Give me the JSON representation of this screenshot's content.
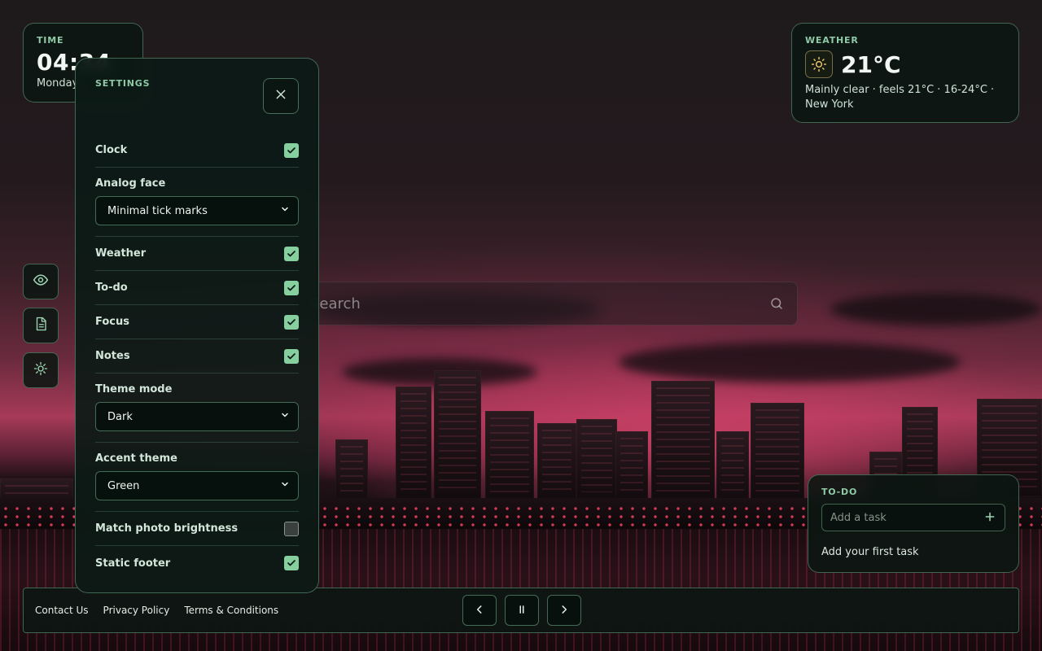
{
  "time_widget": {
    "label": "TIME",
    "time": "04:34",
    "day": "Monday"
  },
  "weather_widget": {
    "label": "WEATHER",
    "icon": "sun-icon",
    "temperature": "21°C",
    "description": "Mainly clear · feels 21°C · 16-24°C · New York"
  },
  "search": {
    "placeholder": "Search",
    "icon": "search-icon"
  },
  "side_rail": [
    {
      "id": "eye",
      "icon": "eye-icon"
    },
    {
      "id": "notes",
      "icon": "document-icon"
    },
    {
      "id": "settings",
      "icon": "gear-icon"
    }
  ],
  "settings": {
    "title": "SETTINGS",
    "close_icon": "close-icon",
    "clock": {
      "label": "Clock",
      "checked": true
    },
    "analog_face": {
      "label": "Analog face",
      "value": "Minimal tick marks"
    },
    "weather": {
      "label": "Weather",
      "checked": true
    },
    "todo": {
      "label": "To-do",
      "checked": true
    },
    "focus": {
      "label": "Focus",
      "checked": true
    },
    "notes": {
      "label": "Notes",
      "checked": true
    },
    "theme_mode": {
      "label": "Theme mode",
      "value": "Dark"
    },
    "accent_theme": {
      "label": "Accent theme",
      "value": "Green"
    },
    "match_brightness": {
      "label": "Match photo brightness",
      "checked": false
    },
    "static_footer": {
      "label": "Static footer",
      "checked": true
    }
  },
  "todo_widget": {
    "label": "TO-DO",
    "placeholder": "Add a task",
    "empty_text": "Add your first task"
  },
  "footer": {
    "links": [
      "Contact Us",
      "Privacy Policy",
      "Terms & Conditions"
    ],
    "controls": [
      "chevron-left-icon",
      "pause-icon",
      "chevron-right-icon"
    ]
  },
  "colors": {
    "accent": "#86cf9f",
    "panel_border": "#82c8a0"
  }
}
